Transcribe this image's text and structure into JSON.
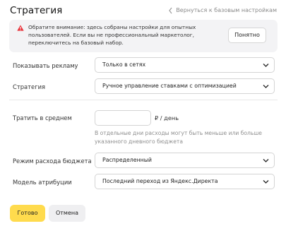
{
  "header": {
    "title": "Стратегия",
    "back_link": "Вернуться к базовым настройкам"
  },
  "notice": {
    "text": "Обратите внимание: здесь собраны настройки для опытных пользователей. Если вы не профессиональный маркетолог, переключитесь на базовый набор.",
    "button": "Понятно",
    "icon_color": "#e8333a"
  },
  "fields": {
    "show_ads": {
      "label": "Показывать рекламу",
      "value": "Только в сетях"
    },
    "strategy": {
      "label": "Стратегия",
      "value": "Ручное управление ставками с оптимизацией"
    },
    "spend": {
      "label": "Тратить в среднем",
      "value": "",
      "unit": "₽ / день",
      "hint": "В отдельные дни расходы могут быть меньше или больше указанного дневного бюджета"
    },
    "budget_mode": {
      "label": "Режим расхода бюджета",
      "value": "Распределенный"
    },
    "attribution": {
      "label": "Модель атрибуции",
      "value": "Последний переход из Яндекс.Директа"
    }
  },
  "actions": {
    "done": "Готово",
    "cancel": "Отмена",
    "primary_color": "#ffdb4d"
  }
}
